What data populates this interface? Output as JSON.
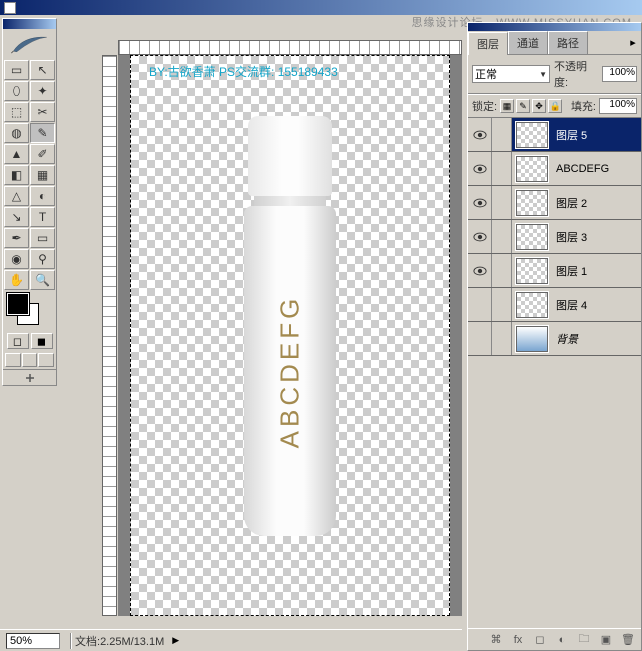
{
  "watermark_top": "思缘设计论坛 · WWW.MISSYUAN.COM",
  "credit_text": "BY:古欲香萧 PS交流群: 155189433",
  "bottle_text": "ABCDEFG",
  "layers_panel": {
    "tabs": {
      "layers": "图层",
      "channels": "通道",
      "paths": "路径"
    },
    "blend_mode": "正常",
    "opacity_label": "不透明度:",
    "opacity_value": "100%",
    "lock_label": "锁定:",
    "fill_label": "填充:",
    "fill_value": "100%",
    "items": [
      {
        "name": "图层 5",
        "visible": true,
        "selected": true,
        "bg": false
      },
      {
        "name": "ABCDEFG",
        "visible": true,
        "selected": false,
        "bg": false
      },
      {
        "name": "图层 2",
        "visible": true,
        "selected": false,
        "bg": false
      },
      {
        "name": "图层 3",
        "visible": true,
        "selected": false,
        "bg": false
      },
      {
        "name": "图层 1",
        "visible": true,
        "selected": false,
        "bg": false
      },
      {
        "name": "图层 4",
        "visible": false,
        "selected": false,
        "bg": false
      },
      {
        "name": "背景",
        "visible": false,
        "selected": false,
        "bg": true,
        "italic": true
      }
    ]
  },
  "statusbar": {
    "zoom": "50%",
    "doc_label": "文档:",
    "doc_size": "2.25M/13.1M"
  },
  "tool_icons": [
    "▭",
    "↖",
    "⬚",
    "✥",
    "⤢",
    "✂",
    "✎",
    "✐",
    "⌖",
    "⟋",
    "△",
    "◧",
    "▲",
    "⬯",
    "◐",
    "✸",
    "↘",
    "T",
    "⬠",
    "⬡",
    "◉",
    "⚲",
    "✋",
    "🔍"
  ]
}
